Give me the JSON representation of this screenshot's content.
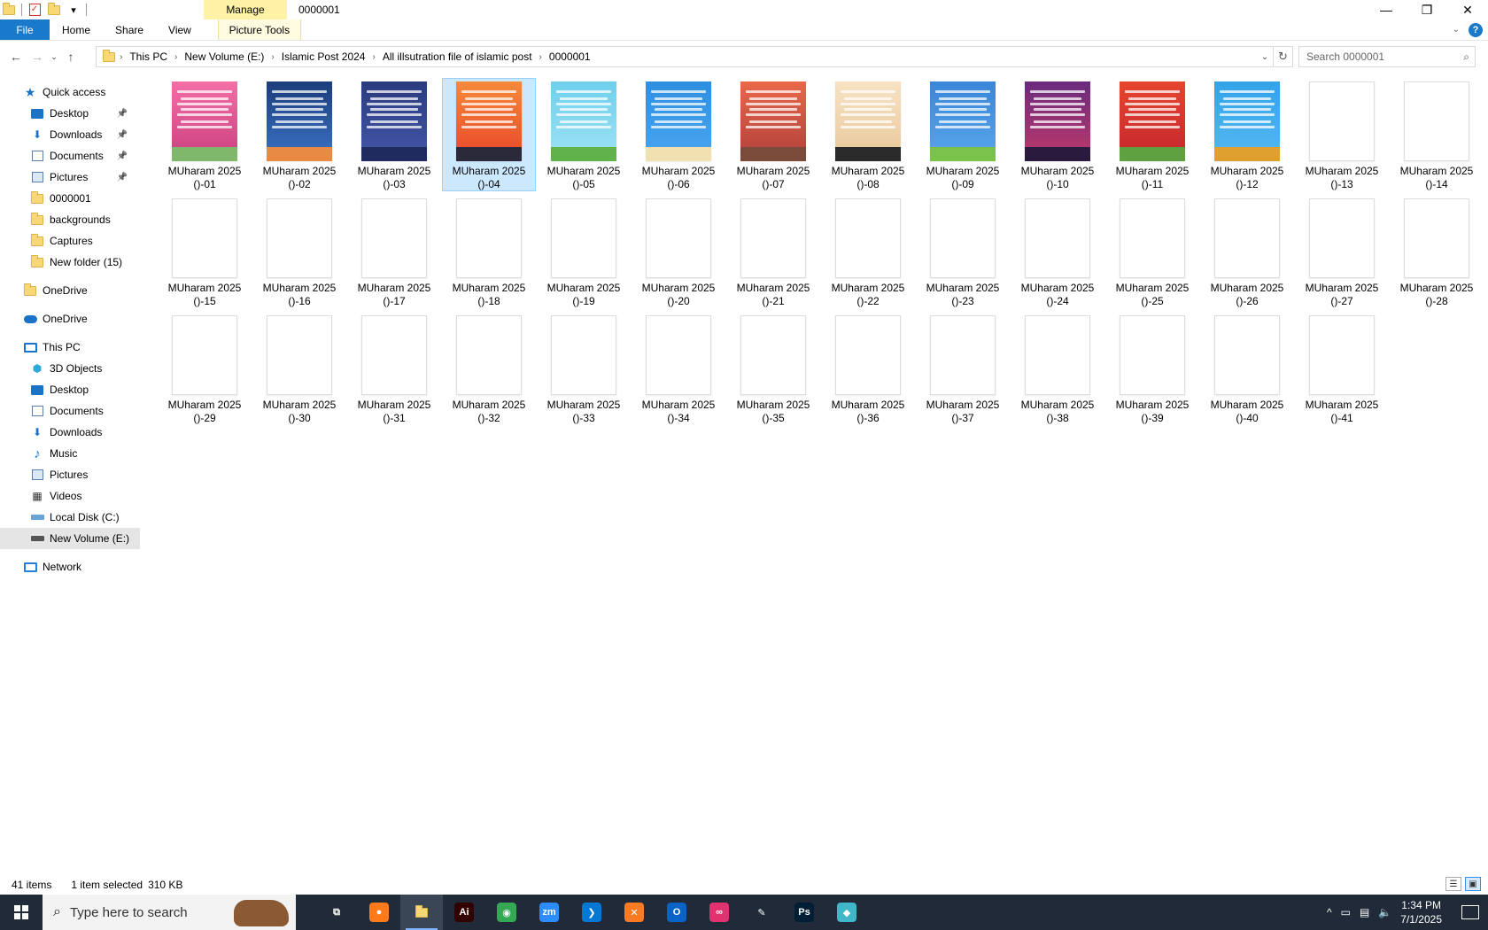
{
  "titlebar": {
    "manage_tab": "Manage",
    "title": "0000001",
    "minimize_glyph": "—",
    "restore_glyph": "❐",
    "close_glyph": "✕"
  },
  "ribbon": {
    "tabs": [
      {
        "label": "File"
      },
      {
        "label": "Home"
      },
      {
        "label": "Share"
      },
      {
        "label": "View"
      },
      {
        "label": "Picture Tools"
      }
    ],
    "help_glyph": "?"
  },
  "address": {
    "crumbs": [
      "This PC",
      "New Volume (E:)",
      "Islamic Post 2024",
      "All illsutration file of islamic post",
      "0000001"
    ],
    "search_placeholder": "Search 0000001"
  },
  "nav": {
    "quick_access": "Quick access",
    "quick_items": [
      {
        "label": "Desktop",
        "icon": "desktop-icon",
        "pinned": true
      },
      {
        "label": "Downloads",
        "icon": "downloads-icon",
        "pinned": true
      },
      {
        "label": "Documents",
        "icon": "documents-icon",
        "pinned": true
      },
      {
        "label": "Pictures",
        "icon": "pictures-icon",
        "pinned": true
      },
      {
        "label": "0000001",
        "icon": "folder-icon",
        "pinned": false
      },
      {
        "label": "backgrounds",
        "icon": "folder-icon",
        "pinned": false
      },
      {
        "label": "Captures",
        "icon": "folder-icon",
        "pinned": false
      },
      {
        "label": "New folder (15)",
        "icon": "folder-icon",
        "pinned": false
      }
    ],
    "onedrive_folder": "OneDrive",
    "onedrive_cloud": "OneDrive",
    "this_pc": "This PC",
    "pc_items": [
      {
        "label": "3D Objects",
        "icon": "3d-objects-icon"
      },
      {
        "label": "Desktop",
        "icon": "desktop-icon"
      },
      {
        "label": "Documents",
        "icon": "documents-icon"
      },
      {
        "label": "Downloads",
        "icon": "downloads-icon"
      },
      {
        "label": "Music",
        "icon": "music-icon"
      },
      {
        "label": "Pictures",
        "icon": "pictures-icon"
      },
      {
        "label": "Videos",
        "icon": "videos-icon"
      },
      {
        "label": "Local Disk (C:)",
        "icon": "local-disk-icon"
      },
      {
        "label": "New Volume (E:)",
        "icon": "drive-icon",
        "selected": true
      }
    ],
    "network": "Network"
  },
  "files": {
    "name_prefix": "MUharam 2025",
    "items": [
      {
        "suffix": "()-01",
        "colors": [
          "#f36fa6",
          "#c93f7e"
        ],
        "ground": "#7fb86a"
      },
      {
        "suffix": "()-02",
        "colors": [
          "#1c3d7a",
          "#3a74c8"
        ],
        "ground": "#e88a43"
      },
      {
        "suffix": "()-03",
        "colors": [
          "#2a3b7e",
          "#4457a8"
        ],
        "ground": "#1f2a5e"
      },
      {
        "suffix": "()-04",
        "colors": [
          "#f6893a",
          "#e8462a"
        ],
        "ground": "#2a2a3a"
      },
      {
        "suffix": "()-05",
        "colors": [
          "#6fd0ee",
          "#9fe2f4"
        ],
        "ground": "#5fb34a"
      },
      {
        "suffix": "()-06",
        "colors": [
          "#2f8fe0",
          "#4aa6ef"
        ],
        "ground": "#f1e0b0"
      },
      {
        "suffix": "()-07",
        "colors": [
          "#e9684a",
          "#b0403a"
        ],
        "ground": "#7a4a3a"
      },
      {
        "suffix": "()-08",
        "colors": [
          "#f7e2c4",
          "#e8c89a"
        ],
        "ground": "#2a2a2a"
      },
      {
        "suffix": "()-09",
        "colors": [
          "#3a86d8",
          "#5aa7ec"
        ],
        "ground": "#7bc24a"
      },
      {
        "suffix": "()-10",
        "colors": [
          "#6a2a7e",
          "#c0396a"
        ],
        "ground": "#2a1a3e"
      },
      {
        "suffix": "()-11",
        "colors": [
          "#e6452e",
          "#c4262e"
        ],
        "ground": "#5fa040"
      },
      {
        "suffix": "()-12",
        "colors": [
          "#33a3e8",
          "#55b9f2"
        ],
        "ground": "#e0a030"
      },
      {
        "suffix": "()-13"
      },
      {
        "suffix": "()-14"
      },
      {
        "suffix": "()-15"
      },
      {
        "suffix": "()-16"
      },
      {
        "suffix": "()-17"
      },
      {
        "suffix": "()-18"
      },
      {
        "suffix": "()-19"
      },
      {
        "suffix": "()-20"
      },
      {
        "suffix": "()-21"
      },
      {
        "suffix": "()-22"
      },
      {
        "suffix": "()-23"
      },
      {
        "suffix": "()-24"
      },
      {
        "suffix": "()-25"
      },
      {
        "suffix": "()-26"
      },
      {
        "suffix": "()-27"
      },
      {
        "suffix": "()-28"
      },
      {
        "suffix": "()-29"
      },
      {
        "suffix": "()-30"
      },
      {
        "suffix": "()-31"
      },
      {
        "suffix": "()-32"
      },
      {
        "suffix": "()-33"
      },
      {
        "suffix": "()-34"
      },
      {
        "suffix": "()-35"
      },
      {
        "suffix": "()-36"
      },
      {
        "suffix": "()-37"
      },
      {
        "suffix": "()-38"
      },
      {
        "suffix": "()-39"
      },
      {
        "suffix": "()-40"
      },
      {
        "suffix": "()-41"
      }
    ],
    "selected_index": 3
  },
  "status": {
    "count": "41 items",
    "selection": "1 item selected",
    "size": "310 KB"
  },
  "taskbar": {
    "search_placeholder": "Type here to search",
    "apps": [
      {
        "name": "task-view-icon",
        "glyph": "⧉",
        "color": "#202a38"
      },
      {
        "name": "firefox-icon",
        "glyph": "●",
        "color": "#ff7a1a"
      },
      {
        "name": "file-explorer-icon",
        "glyph": "",
        "color": "#f8d775",
        "active": true
      },
      {
        "name": "illustrator-icon",
        "glyph": "Ai",
        "color": "#330000"
      },
      {
        "name": "chrome-icon",
        "glyph": "◉",
        "color": "#34a853"
      },
      {
        "name": "zoom-icon",
        "glyph": "zm",
        "color": "#2d8cff"
      },
      {
        "name": "vscode-icon",
        "glyph": "❯",
        "color": "#0078d4"
      },
      {
        "name": "xampp-icon",
        "glyph": "✕",
        "color": "#fb7a24"
      },
      {
        "name": "outlook-icon",
        "glyph": "O",
        "color": "#0a64c8"
      },
      {
        "name": "creative-cloud-icon",
        "glyph": "∞",
        "color": "#e0326e"
      },
      {
        "name": "pen-tool-icon",
        "glyph": "✎",
        "color": "#202a38"
      },
      {
        "name": "photoshop-icon",
        "glyph": "Ps",
        "color": "#001e36"
      },
      {
        "name": "app-icon",
        "glyph": "◆",
        "color": "#3fb7c8"
      }
    ],
    "time": "1:34 PM",
    "date": "7/1/2025"
  }
}
